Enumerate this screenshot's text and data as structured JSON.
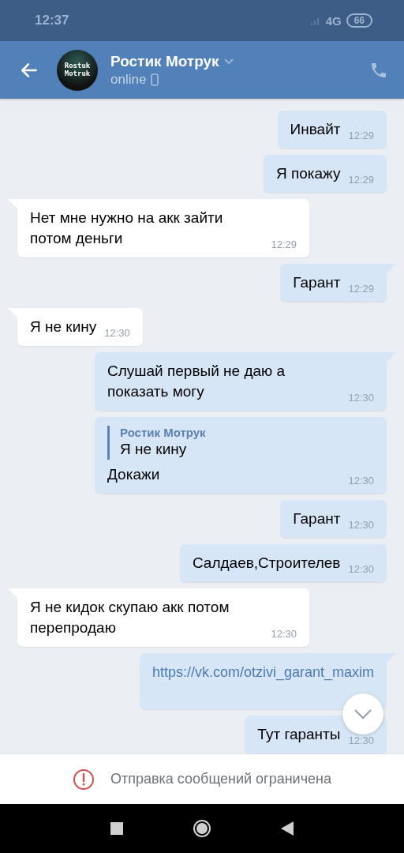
{
  "status_bar": {
    "time": "12:37",
    "network": "4G",
    "battery": "66"
  },
  "header": {
    "name": "Ростик Мотрук",
    "status": "online",
    "avatar_text": "Rostuk Motruk"
  },
  "messages": [
    {
      "kind": "outgoing",
      "tail": false,
      "text": "Инвайт",
      "time": "12:29"
    },
    {
      "kind": "outgoing",
      "tail": false,
      "text": "Я покажу",
      "time": "12:29"
    },
    {
      "kind": "incoming",
      "tail": true,
      "text": "Нет мне нужно на акк зайти потом деньги",
      "time": "12:29"
    },
    {
      "kind": "outgoing",
      "tail": true,
      "text": "Гарант",
      "time": "12:29"
    },
    {
      "kind": "incoming",
      "tail": true,
      "text": "Я не кину",
      "time": "12:30"
    },
    {
      "kind": "outgoing",
      "tail": true,
      "text": "Слушай первый не даю а показать могу",
      "time": "12:30"
    },
    {
      "kind": "outgoing",
      "tail": false,
      "text": "Докажи",
      "time": "12:30",
      "reply": {
        "author": "Ростик Мотрук",
        "text": "Я не кину"
      }
    },
    {
      "kind": "outgoing",
      "tail": false,
      "text": "Гарант",
      "time": "12:30"
    },
    {
      "kind": "outgoing",
      "tail": false,
      "text": "Салдаев,Строителев",
      "time": "12:30"
    },
    {
      "kind": "incoming",
      "tail": true,
      "text": "Я не кидок скупаю акк потом перепродаю",
      "time": "12:30"
    },
    {
      "kind": "link",
      "tail": true,
      "text": "https://vk.com/otzivi_garant_maxim"
    },
    {
      "kind": "outgoing",
      "tail": false,
      "text": "Тут гаранты",
      "time": "12:30"
    }
  ],
  "notice": "Отправка сообщений ограничена"
}
